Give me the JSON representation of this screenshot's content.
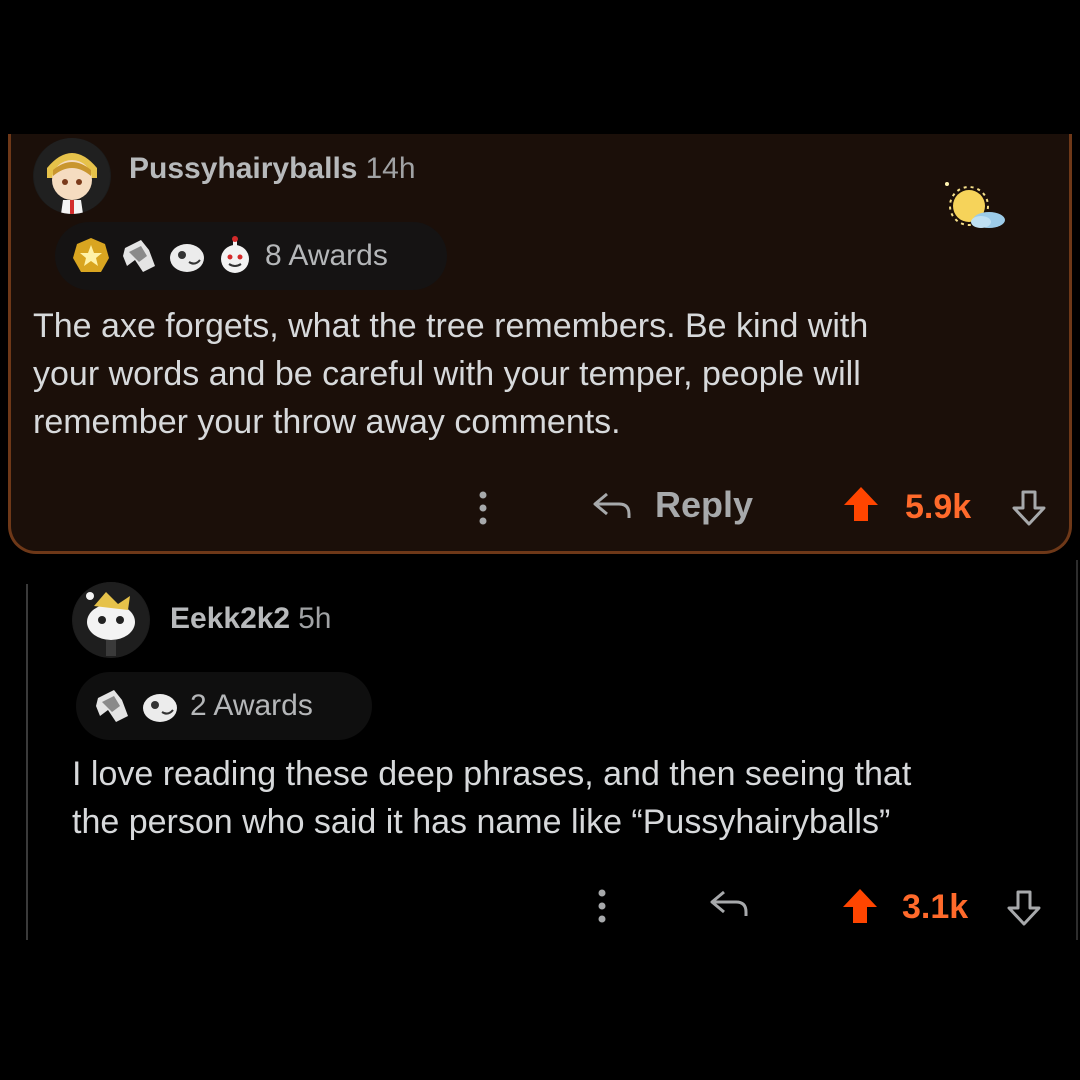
{
  "comments": [
    {
      "username": "Pussyhairyballs",
      "time": "14h",
      "awards_label": "8 Awards",
      "award_icons": [
        "gold-star-award-icon",
        "wholesome-seal-award-icon",
        "helpful-award-icon",
        "wholesome-award-icon"
      ],
      "flair_icon": "sun-cloud-icon",
      "body": "The axe forgets, what the tree remembers. Be kind with\nyour words and be careful with your temper, people will\nremember your throw away comments.",
      "reply_label": "Reply",
      "score": "5.9k",
      "highlighted": true
    },
    {
      "username": "Eekk2k2",
      "time": "5h",
      "awards_label": "2 Awards",
      "award_icons": [
        "wholesome-seal-award-icon",
        "helpful-award-icon"
      ],
      "body": "I love reading these deep phrases, and then seeing that\nthe person who said it has name like “Pussyhairyballs”",
      "score": "3.1k",
      "highlighted": false
    }
  ],
  "colors": {
    "upvote": "#ff4500",
    "score": "#ff6a2b",
    "highlight_border": "#6e3818",
    "highlight_bg": "#1b0f09"
  }
}
